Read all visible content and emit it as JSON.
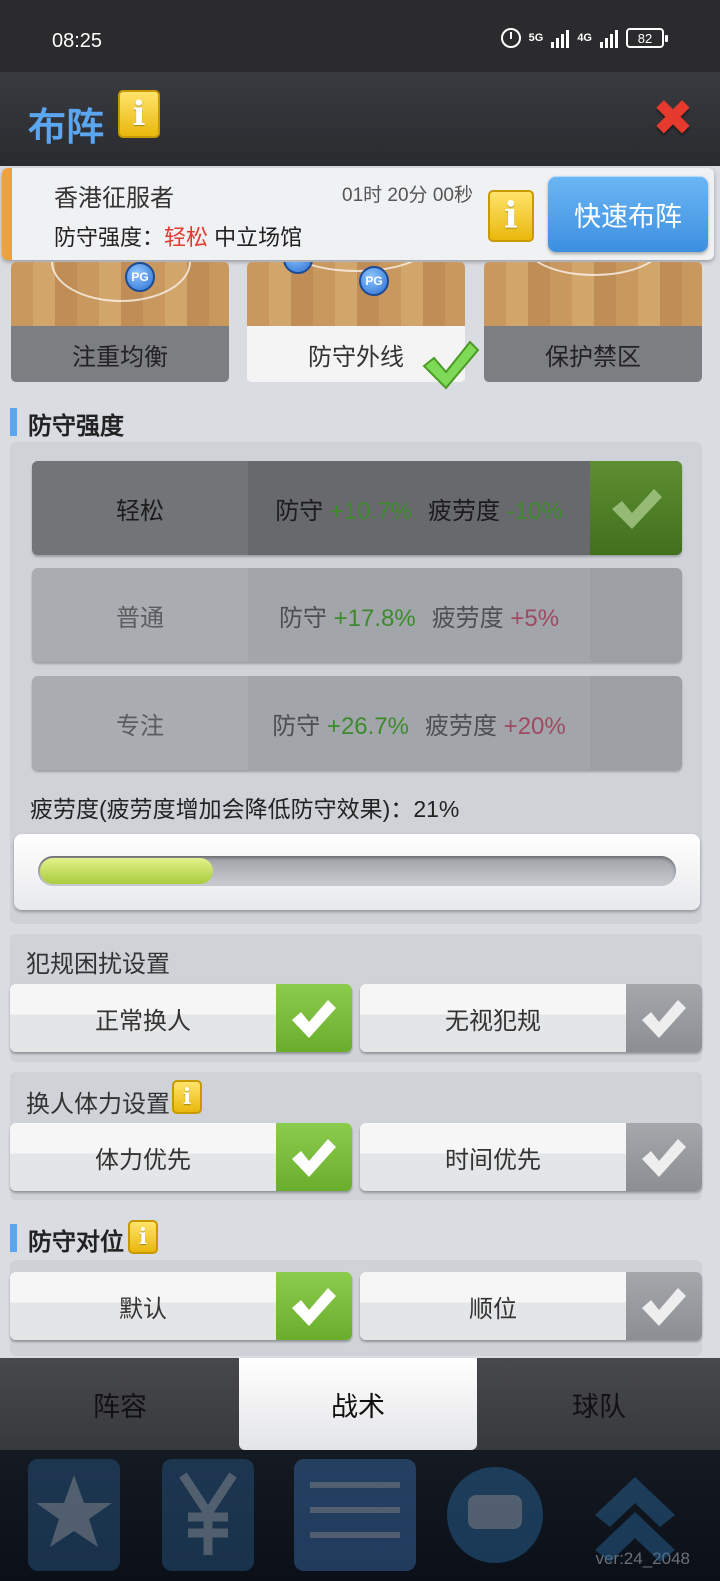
{
  "status_bar": {
    "time": "08:25",
    "battery": "82",
    "net1": "5G",
    "net2": "4G"
  },
  "header": {
    "title": "布阵",
    "info_icon": "i"
  },
  "match": {
    "team": "香港征服者",
    "countdown": "01时 20分 00秒",
    "intensity_label": "防守强度：",
    "intensity_value": "轻松",
    "venue": "中立场馆",
    "quick_button": "快速布阵"
  },
  "formations": [
    {
      "label": "注重均衡",
      "selected": false
    },
    {
      "label": "防守外线",
      "selected": true
    },
    {
      "label": "保护禁区",
      "selected": false
    }
  ],
  "pg_label": "PG",
  "defense_intensity": {
    "title": "防守强度",
    "defense_word": "防守",
    "fatigue_word": "疲劳度",
    "options": [
      {
        "name": "轻松",
        "defense": "+10.7%",
        "fatigue": "-10%",
        "selected": true
      },
      {
        "name": "普通",
        "defense": "+17.8%",
        "fatigue": "+5%",
        "selected": false
      },
      {
        "name": "专注",
        "defense": "+26.7%",
        "fatigue": "+20%",
        "selected": false
      }
    ],
    "fatigue_text": "疲劳度(疲劳度增加会降低防守效果)：21%",
    "fatigue_percent": 21
  },
  "foul_settings": {
    "title": "犯规困扰设置",
    "options": [
      {
        "label": "正常换人",
        "on": true
      },
      {
        "label": "无视犯规",
        "on": false
      }
    ]
  },
  "stamina_settings": {
    "title": "换人体力设置",
    "options": [
      {
        "label": "体力优先",
        "on": true
      },
      {
        "label": "时间优先",
        "on": false
      }
    ]
  },
  "matchup": {
    "title": "防守对位",
    "options": [
      {
        "label": "默认",
        "on": true
      },
      {
        "label": "顺位",
        "on": false
      }
    ]
  },
  "tabs": [
    {
      "label": "阵容"
    },
    {
      "label": "战术",
      "active": true
    },
    {
      "label": "球队"
    }
  ],
  "version": "ver:24_2048"
}
